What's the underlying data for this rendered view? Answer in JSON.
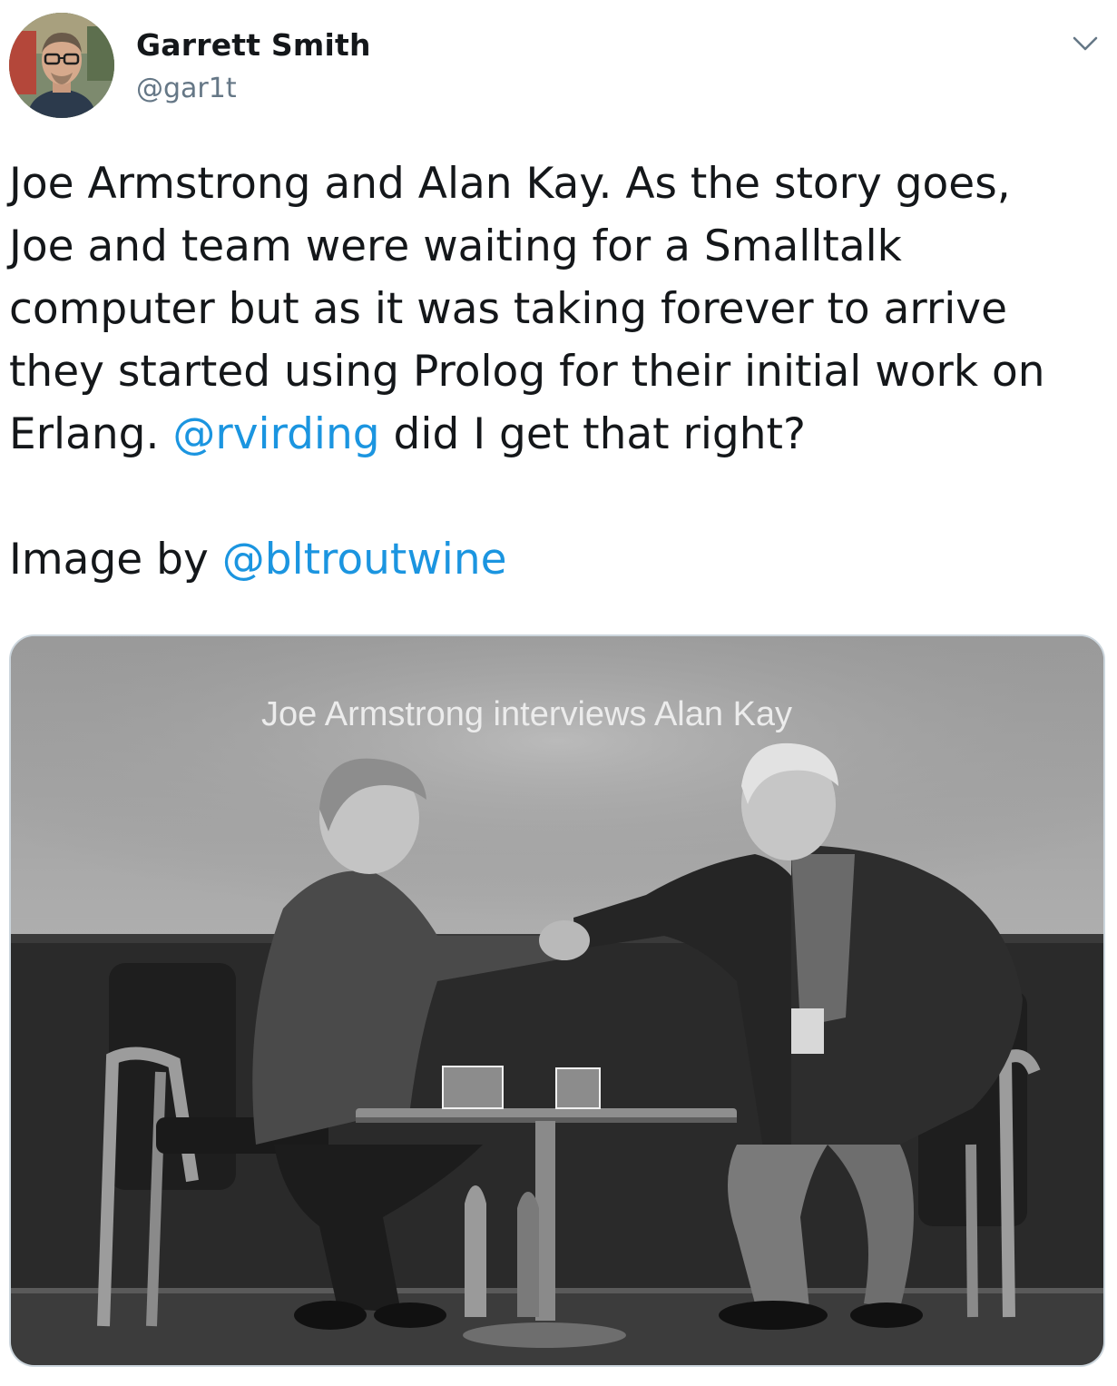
{
  "author": {
    "name": "Garrett Smith",
    "handle": "@gar1t",
    "avatar_icon": "profile-photo"
  },
  "menu": {
    "icon": "chevron-down-icon"
  },
  "tweet": {
    "line1": "Joe Armstrong and Alan Kay. As the story goes,",
    "line2": "Joe and team were waiting for a Smalltalk",
    "line3": "computer but as it was taking forever to arrive",
    "line4": "they started using Prolog for their initial work on",
    "line5_start": "Erlang. ",
    "mention1": "@rvirding",
    "line5_end": " did I get that right?",
    "credit_prefix": "Image by ",
    "mention2": "@bltroutwine"
  },
  "media": {
    "banner_text": "Joe Armstrong interviews Alan Kay"
  },
  "colors": {
    "link": "#1b95e0",
    "secondary_text": "#657786",
    "border": "#ccd6dd"
  }
}
